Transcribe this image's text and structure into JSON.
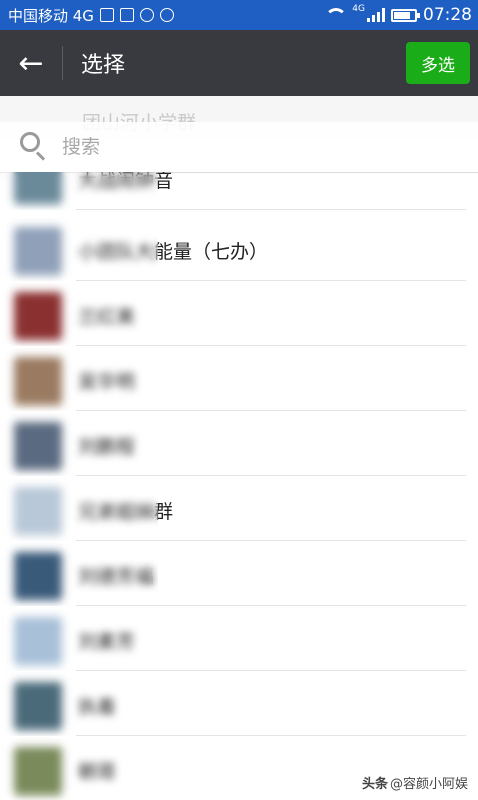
{
  "status_bar": {
    "carrier": "中国移动 4G",
    "network_badge": "4G",
    "time": "07:28",
    "icons": [
      "alert-icon",
      "image-icon",
      "emoji-icon",
      "coin-icon",
      "wifi-icon",
      "signal-icon",
      "battery-icon"
    ]
  },
  "action_bar": {
    "back_icon": "←",
    "title": "选择",
    "multi_select_label": "多选"
  },
  "group_header": {
    "label": "团山河小学群"
  },
  "search": {
    "placeholder": "搜索"
  },
  "contacts": [
    {
      "name": "大战闹钟音",
      "avatar_color": "#6a8a9a"
    },
    {
      "name": "小团队大能量（七办）",
      "avatar_color": "#8fa0b8"
    },
    {
      "name": "兰红美",
      "avatar_color": "#8a3030"
    },
    {
      "name": "吴华明",
      "avatar_color": "#9a7a60"
    },
    {
      "name": "刘鹏程",
      "avatar_color": "#5a6a80"
    },
    {
      "name": "兄弟姐妹群",
      "avatar_color": "#b8c8d8"
    },
    {
      "name": "刘德芳福",
      "avatar_color": "#3a5a7a"
    },
    {
      "name": "刘素芳",
      "avatar_color": "#a8c0d8"
    },
    {
      "name": "执着",
      "avatar_color": "#4a6a7a"
    },
    {
      "name": "朝哥",
      "avatar_color": "#7a8a5a"
    }
  ],
  "watermark": {
    "prefix": "头条",
    "handle": "@容颜小阿娱"
  }
}
